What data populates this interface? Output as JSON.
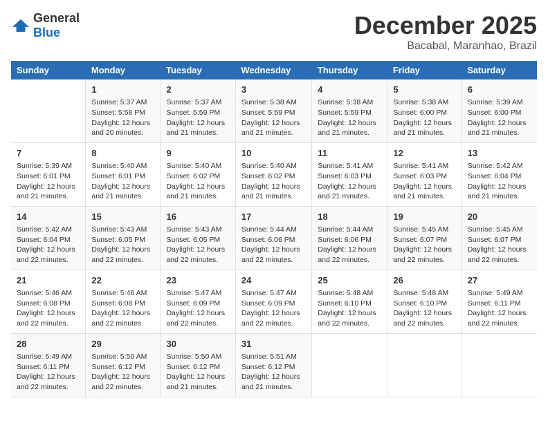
{
  "logo": {
    "general": "General",
    "blue": "Blue"
  },
  "header": {
    "month": "December 2025",
    "location": "Bacabal, Maranhao, Brazil"
  },
  "weekdays": [
    "Sunday",
    "Monday",
    "Tuesday",
    "Wednesday",
    "Thursday",
    "Friday",
    "Saturday"
  ],
  "weeks": [
    [
      {
        "day": "",
        "info": ""
      },
      {
        "day": "1",
        "info": "Sunrise: 5:37 AM\nSunset: 5:58 PM\nDaylight: 12 hours\nand 20 minutes."
      },
      {
        "day": "2",
        "info": "Sunrise: 5:37 AM\nSunset: 5:59 PM\nDaylight: 12 hours\nand 21 minutes."
      },
      {
        "day": "3",
        "info": "Sunrise: 5:38 AM\nSunset: 5:59 PM\nDaylight: 12 hours\nand 21 minutes."
      },
      {
        "day": "4",
        "info": "Sunrise: 5:38 AM\nSunset: 5:59 PM\nDaylight: 12 hours\nand 21 minutes."
      },
      {
        "day": "5",
        "info": "Sunrise: 5:38 AM\nSunset: 6:00 PM\nDaylight: 12 hours\nand 21 minutes."
      },
      {
        "day": "6",
        "info": "Sunrise: 5:39 AM\nSunset: 6:00 PM\nDaylight: 12 hours\nand 21 minutes."
      }
    ],
    [
      {
        "day": "7",
        "info": "Sunrise: 5:39 AM\nSunset: 6:01 PM\nDaylight: 12 hours\nand 21 minutes."
      },
      {
        "day": "8",
        "info": "Sunrise: 5:40 AM\nSunset: 6:01 PM\nDaylight: 12 hours\nand 21 minutes."
      },
      {
        "day": "9",
        "info": "Sunrise: 5:40 AM\nSunset: 6:02 PM\nDaylight: 12 hours\nand 21 minutes."
      },
      {
        "day": "10",
        "info": "Sunrise: 5:40 AM\nSunset: 6:02 PM\nDaylight: 12 hours\nand 21 minutes."
      },
      {
        "day": "11",
        "info": "Sunrise: 5:41 AM\nSunset: 6:03 PM\nDaylight: 12 hours\nand 21 minutes."
      },
      {
        "day": "12",
        "info": "Sunrise: 5:41 AM\nSunset: 6:03 PM\nDaylight: 12 hours\nand 21 minutes."
      },
      {
        "day": "13",
        "info": "Sunrise: 5:42 AM\nSunset: 6:04 PM\nDaylight: 12 hours\nand 21 minutes."
      }
    ],
    [
      {
        "day": "14",
        "info": "Sunrise: 5:42 AM\nSunset: 6:04 PM\nDaylight: 12 hours\nand 22 minutes."
      },
      {
        "day": "15",
        "info": "Sunrise: 5:43 AM\nSunset: 6:05 PM\nDaylight: 12 hours\nand 22 minutes."
      },
      {
        "day": "16",
        "info": "Sunrise: 5:43 AM\nSunset: 6:05 PM\nDaylight: 12 hours\nand 22 minutes."
      },
      {
        "day": "17",
        "info": "Sunrise: 5:44 AM\nSunset: 6:06 PM\nDaylight: 12 hours\nand 22 minutes."
      },
      {
        "day": "18",
        "info": "Sunrise: 5:44 AM\nSunset: 6:06 PM\nDaylight: 12 hours\nand 22 minutes."
      },
      {
        "day": "19",
        "info": "Sunrise: 5:45 AM\nSunset: 6:07 PM\nDaylight: 12 hours\nand 22 minutes."
      },
      {
        "day": "20",
        "info": "Sunrise: 5:45 AM\nSunset: 6:07 PM\nDaylight: 12 hours\nand 22 minutes."
      }
    ],
    [
      {
        "day": "21",
        "info": "Sunrise: 5:46 AM\nSunset: 6:08 PM\nDaylight: 12 hours\nand 22 minutes."
      },
      {
        "day": "22",
        "info": "Sunrise: 5:46 AM\nSunset: 6:08 PM\nDaylight: 12 hours\nand 22 minutes."
      },
      {
        "day": "23",
        "info": "Sunrise: 5:47 AM\nSunset: 6:09 PM\nDaylight: 12 hours\nand 22 minutes."
      },
      {
        "day": "24",
        "info": "Sunrise: 5:47 AM\nSunset: 6:09 PM\nDaylight: 12 hours\nand 22 minutes."
      },
      {
        "day": "25",
        "info": "Sunrise: 5:48 AM\nSunset: 6:10 PM\nDaylight: 12 hours\nand 22 minutes."
      },
      {
        "day": "26",
        "info": "Sunrise: 5:48 AM\nSunset: 6:10 PM\nDaylight: 12 hours\nand 22 minutes."
      },
      {
        "day": "27",
        "info": "Sunrise: 5:49 AM\nSunset: 6:11 PM\nDaylight: 12 hours\nand 22 minutes."
      }
    ],
    [
      {
        "day": "28",
        "info": "Sunrise: 5:49 AM\nSunset: 6:11 PM\nDaylight: 12 hours\nand 22 minutes."
      },
      {
        "day": "29",
        "info": "Sunrise: 5:50 AM\nSunset: 6:12 PM\nDaylight: 12 hours\nand 22 minutes."
      },
      {
        "day": "30",
        "info": "Sunrise: 5:50 AM\nSunset: 6:12 PM\nDaylight: 12 hours\nand 21 minutes."
      },
      {
        "day": "31",
        "info": "Sunrise: 5:51 AM\nSunset: 6:12 PM\nDaylight: 12 hours\nand 21 minutes."
      },
      {
        "day": "",
        "info": ""
      },
      {
        "day": "",
        "info": ""
      },
      {
        "day": "",
        "info": ""
      }
    ]
  ]
}
